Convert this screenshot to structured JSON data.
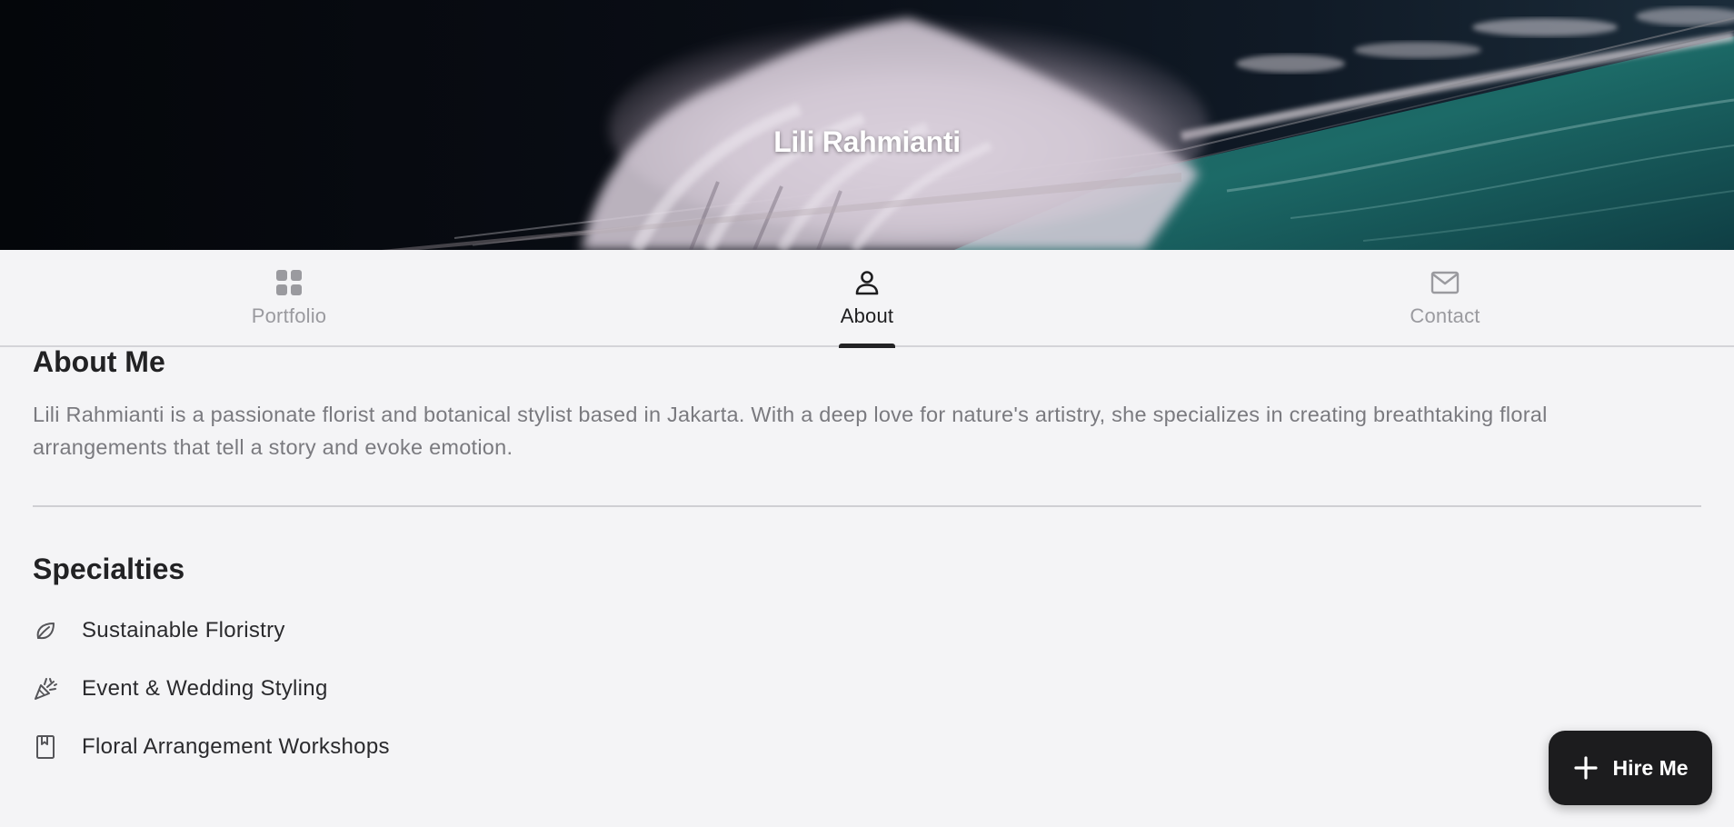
{
  "hero": {
    "title": "Lili Rahmianti"
  },
  "tabs": [
    {
      "label": "Portfolio",
      "icon": "grid-icon",
      "active": false
    },
    {
      "label": "About",
      "icon": "person-icon",
      "active": true
    },
    {
      "label": "Contact",
      "icon": "mail-icon",
      "active": false
    }
  ],
  "about": {
    "heading": "About Me",
    "text": "Lili Rahmianti is a passionate florist and botanical stylist based in Jakarta. With a deep love for nature's artistry, she specializes in creating breathtaking floral arrangements that tell a story and evoke emotion."
  },
  "specialties": {
    "heading": "Specialties",
    "items": [
      {
        "label": "Sustainable Floristry",
        "icon": "leaf-icon"
      },
      {
        "label": "Event & Wedding Styling",
        "icon": "party-popper-icon"
      },
      {
        "label": "Floral Arrangement Workshops",
        "icon": "book-icon"
      }
    ]
  },
  "fab": {
    "label": "Hire Me",
    "icon": "plus-icon"
  },
  "colors": {
    "background": "#f4f4f6",
    "accent_dark": "#1c1c1e",
    "muted_text": "#7a7a7f",
    "inactive_tab": "#9a9a9f"
  }
}
